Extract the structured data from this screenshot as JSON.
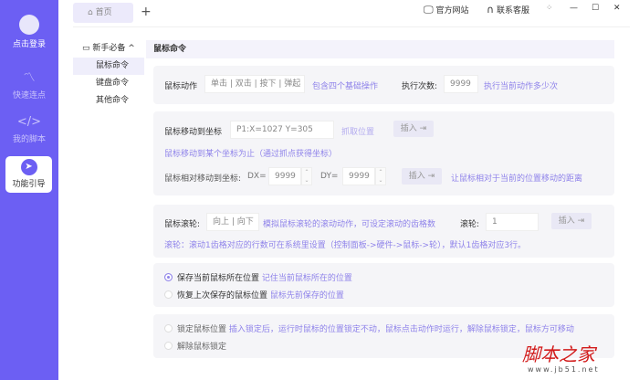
{
  "sidebar": {
    "login": "点击登录",
    "items": [
      {
        "label": "快速连点",
        "icon": "connect-icon"
      },
      {
        "label": "我的脚本",
        "icon": "code-icon"
      },
      {
        "label": "功能引导",
        "icon": "send-icon",
        "active": true
      }
    ]
  },
  "tabs": {
    "home": "首页",
    "add": "+"
  },
  "topbar": {
    "website": "官方网站",
    "support": "联系客服"
  },
  "nav": {
    "group": "新手必备",
    "items": [
      "鼠标命令",
      "键盘命令",
      "其他命令"
    ]
  },
  "main": {
    "title": "鼠标命令",
    "action": {
      "label": "鼠标动作",
      "value": "单击 | 双击 | 按下 | 弹起",
      "hint": "包含四个基础操作",
      "count_label": "执行次数:",
      "count": "9999",
      "count_hint": "执行当前动作多少次"
    },
    "move": {
      "label": "鼠标移动到坐标",
      "value": "P1:X=1027 Y=305",
      "grab": "抓取位置",
      "insert": "插入",
      "hint": "鼠标移动到某个坐标为止（通过抓点获得坐标）",
      "rel_label": "鼠标相对移动到坐标:",
      "dx_label": "DX=",
      "dx": "9999",
      "dy_label": "DY=",
      "dy": "9999",
      "rel_hint": "让鼠标相对于当前的位置移动的距离"
    },
    "wheel": {
      "label": "鼠标滚轮:",
      "value": "向上 | 向下",
      "hint": "模拟鼠标滚轮的滚动动作，可设定滚动的齿格数",
      "count_label": "滚轮:",
      "count": "1",
      "insert": "插入",
      "note": "滚轮：滚动1齿格对应的行数可在系统里设置（控制面板->硬件->鼠标->轮），默认1齿格对应3行。"
    },
    "position": [
      {
        "label": "保存当前鼠标所在位置",
        "hint": "记住当前鼠标所在的位置",
        "checked": true
      },
      {
        "label": "恢复上次保存的鼠标位置",
        "hint": "鼠标先前保存的位置",
        "checked": false
      }
    ],
    "lock": [
      {
        "label": "锁定鼠标位置",
        "hint": "插入锁定后，运行时鼠标的位置锁定不动，鼠标点击动作时运行，解除鼠标锁定，鼠标方可移动"
      },
      {
        "label": "解除鼠标锁定",
        "hint": ""
      }
    ]
  },
  "watermark": {
    "text": "脚本之家",
    "url": "www.jb51.net"
  },
  "colors": {
    "accent": "#6c5ff3",
    "hint": "#8f83ea"
  }
}
